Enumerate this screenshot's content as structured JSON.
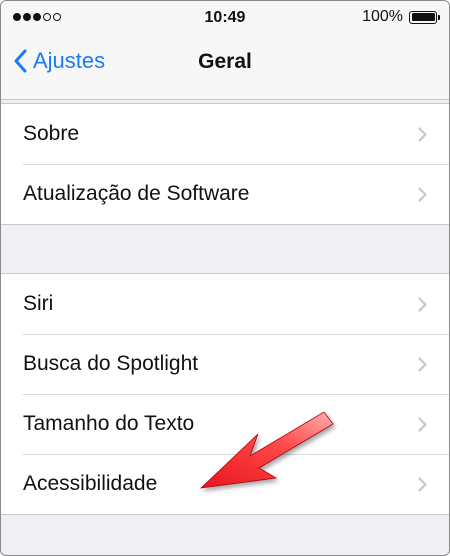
{
  "status_bar": {
    "signal_bars_filled": 3,
    "signal_bars_total": 5,
    "time": "10:49",
    "battery_percent": "100%"
  },
  "nav": {
    "back_label": "Ajustes",
    "title": "Geral"
  },
  "groups": [
    {
      "items": [
        {
          "label": "Sobre"
        },
        {
          "label": "Atualização de Software"
        }
      ]
    },
    {
      "items": [
        {
          "label": "Siri"
        },
        {
          "label": "Busca do Spotlight"
        },
        {
          "label": "Tamanho do Texto"
        },
        {
          "label": "Acessibilidade"
        }
      ]
    }
  ],
  "icons": {
    "row_chevron": "chevron-right-icon",
    "back": "chevron-left-icon",
    "annotation": "red-arrow-icon"
  },
  "colors": {
    "accent": "#1a7cf5",
    "annotation": "#e8141c",
    "background": "#efeff4"
  }
}
